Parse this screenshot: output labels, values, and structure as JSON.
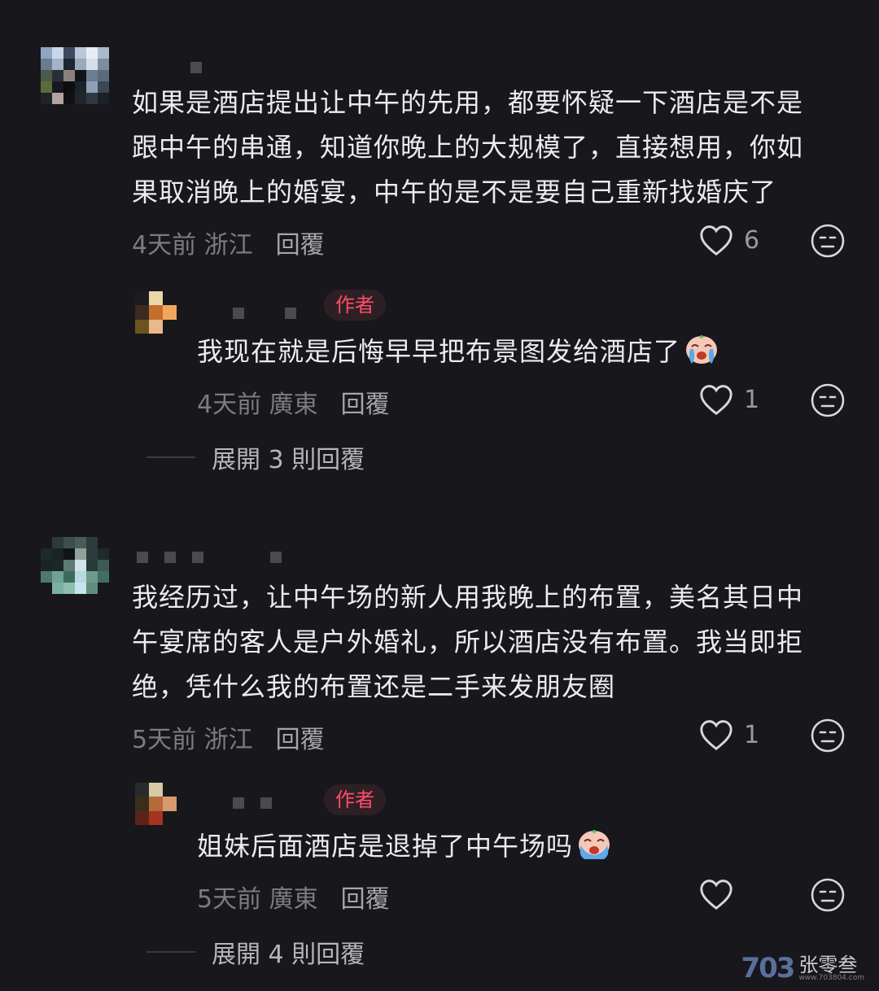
{
  "comments": [
    {
      "text_lines": [
        "如果是酒店提出让中午的先用，都要怀疑一下酒店是不是",
        "跟中午的串通，知道你晚上的大规模了，直接想用，你如",
        "果取消晚上的婚宴，中午的是不是要自己重新找婚庆了"
      ],
      "time": "4天前",
      "location": "浙江",
      "reply_label": "回覆",
      "likes": "6",
      "replies": [
        {
          "author_badge": "作者",
          "text": "我现在就是后悔早早把布景图发给酒店了",
          "emoji": "crying-face",
          "time": "4天前",
          "location": "廣東",
          "reply_label": "回覆",
          "likes": "1"
        }
      ],
      "expand_label": "展開 3 則回覆"
    },
    {
      "text_lines": [
        "我经历过，让中午场的新人用我晚上的布置，美名其日中",
        "午宴席的客人是户外婚礼，所以酒店没有布置。我当即拒",
        "绝，凭什么我的布置还是二手来发朋友圈"
      ],
      "time": "5天前",
      "location": "浙江",
      "reply_label": "回覆",
      "likes": "1",
      "replies": [
        {
          "author_badge": "作者",
          "text": "姐妹后面酒店是退掉了中午场吗",
          "emoji": "crying-face",
          "time": "5天前",
          "location": "廣東",
          "reply_label": "回覆",
          "likes": ""
        }
      ],
      "expand_label": "展開 4 則回覆"
    }
  ],
  "icons": {
    "like": "heart-outline-icon",
    "dislike": "neutral-face-icon"
  },
  "colors": {
    "background": "#17171c",
    "author_badge": "#ff4d6a",
    "meta": "#7b7b82"
  },
  "watermark": {
    "mark": "703",
    "text": "张零叁",
    "url": "www.703804.com"
  }
}
